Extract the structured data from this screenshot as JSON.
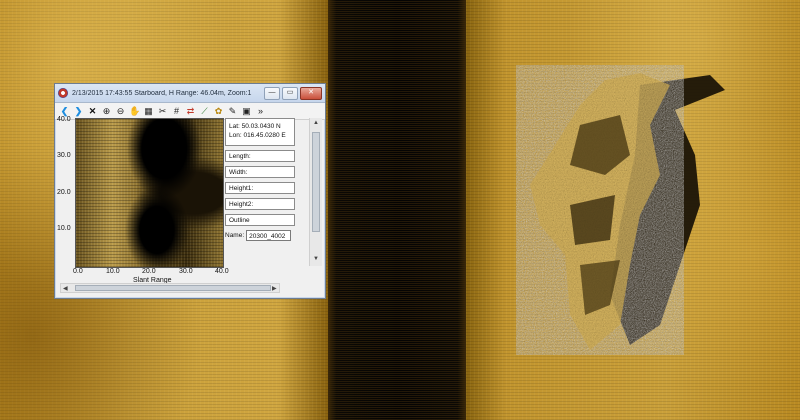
{
  "window": {
    "title": "2/13/2015 17:43:55 Starboard, H Range: 46.04m, Zoom:1",
    "minimize": "—",
    "maximize": "▭",
    "close": "✕"
  },
  "toolbar": {
    "icons": [
      "back-icon",
      "forward-icon",
      "delete-icon",
      "zoom-in-icon",
      "zoom-out-icon",
      "pan-icon",
      "grid-icon",
      "measure-icon",
      "swap-icon",
      "palette-icon",
      "chart-icon",
      "settings-icon",
      "edit-icon",
      "save-icon",
      "more-icon"
    ]
  },
  "plot": {
    "y_ticks": [
      "40.0",
      "30.0",
      "20.0",
      "10.0"
    ],
    "x_ticks": [
      "0.0",
      "10.0",
      "20.0",
      "30.0",
      "40.0"
    ],
    "x_label": "Slant Range"
  },
  "fields": {
    "lat": "Lat:  50.03.0430 N",
    "lon": "Lon:  016.45.0280 E",
    "length": "Length:",
    "width": "Width:",
    "height1": "Height1:",
    "height2": "Height2:",
    "outline": "Outline",
    "name_label": "Name:",
    "name_value": "20300_4002"
  },
  "colors": {
    "sonar_gold": "#c9a03a",
    "water_black": "#050505"
  }
}
